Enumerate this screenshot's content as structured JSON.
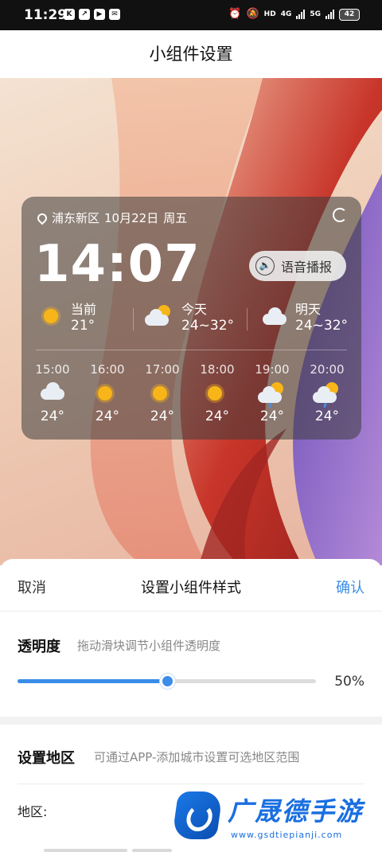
{
  "status_bar": {
    "time": "11:29",
    "app_icons": [
      "K",
      "↗",
      "▶",
      "✉"
    ],
    "network_1": "4G",
    "network_2": "5G",
    "hd_label": "HD",
    "battery": "42"
  },
  "header": {
    "title": "小组件设置"
  },
  "widget": {
    "location": "浦东新区",
    "date": "10月22日",
    "weekday": "周五",
    "time": "14:07",
    "voice_label": "语音播报",
    "current": {
      "label": "当前",
      "temp": "21°",
      "icon": "sun-icon"
    },
    "today": {
      "label": "今天",
      "temp": "24~32°",
      "icon": "partly-cloudy-icon"
    },
    "tomorrow": {
      "label": "明天",
      "temp": "24~32°",
      "icon": "cloud-icon"
    },
    "hourly": [
      {
        "hour": "15:00",
        "temp": "24°",
        "icon": "cloud"
      },
      {
        "hour": "16:00",
        "temp": "24°",
        "icon": "sun"
      },
      {
        "hour": "17:00",
        "temp": "24°",
        "icon": "sun"
      },
      {
        "hour": "18:00",
        "temp": "24°",
        "icon": "sun"
      },
      {
        "hour": "19:00",
        "temp": "24°",
        "icon": "partly-cloudy-rain"
      },
      {
        "hour": "20:00",
        "temp": "24°",
        "icon": "partly-cloudy-rain"
      }
    ]
  },
  "sheet": {
    "cancel_label": "取消",
    "title": "设置小组件样式",
    "confirm_label": "确认",
    "opacity": {
      "title": "透明度",
      "hint": "拖动滑块调节小组件透明度",
      "value_text": "50%",
      "fraction": 0.5
    },
    "region": {
      "title": "设置地区",
      "hint": "可通过APP-添加城市设置可选地区范围",
      "label": "地区:"
    }
  },
  "watermark": {
    "brand": "广晟德手游",
    "url": "www.gsdtiepianji.com"
  },
  "colors": {
    "accent": "#3a8de8",
    "sun": "#f7b51a",
    "status_bar_bg": "#111111"
  }
}
